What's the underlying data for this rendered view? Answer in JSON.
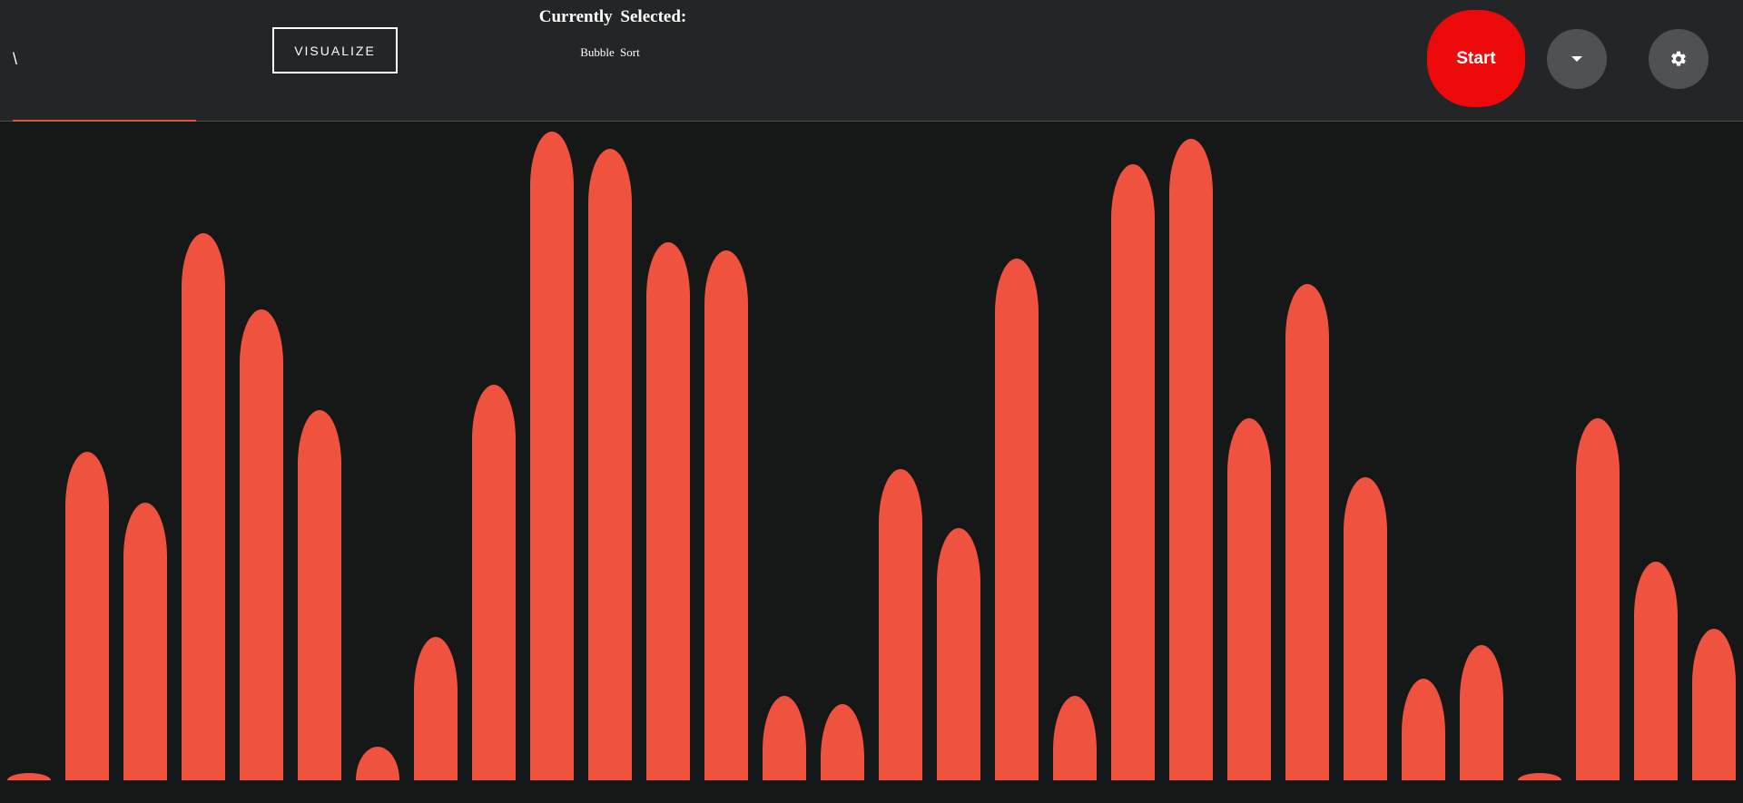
{
  "header": {
    "size_input_value": "\\",
    "visualize_label": "VISUALIZE",
    "selected_title": "Currently  Selected:",
    "selected_algorithm": "Bubble  Sort",
    "start_label": "Start",
    "dropdown_icon": "caret-down-icon",
    "settings_icon": "gear-icon"
  },
  "colors": {
    "bar": "#ef5340",
    "start_button": "#ee0a0a",
    "background": "#161717",
    "toolbar": "#242527",
    "accent_underline": "#e15540"
  },
  "bars": {
    "max_value": 715,
    "values": [
      8,
      362,
      306,
      603,
      519,
      408,
      37,
      158,
      436,
      715,
      696,
      593,
      584,
      93,
      84,
      343,
      278,
      575,
      93,
      679,
      707,
      399,
      547,
      334,
      112,
      149,
      8,
      399,
      241,
      167
    ]
  }
}
